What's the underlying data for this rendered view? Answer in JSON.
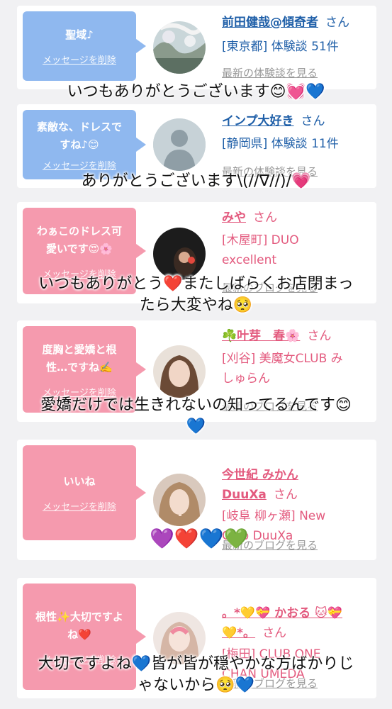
{
  "cards": [
    {
      "message": "聖域♪",
      "delete_label": "メッセージを削除",
      "name": "前田健哉@傾奇者",
      "honorific": "さん",
      "area": "[東京都] 体験談 51件",
      "latest_link": "最新の体験談を見る",
      "overlay": "いつもありがとうございます😊💓💙",
      "theme_color": "#8fb8ef"
    },
    {
      "message": "素敵な、ドレスで\nすね♪😊",
      "delete_label": "メッセージを削除",
      "name": "インプ大好き",
      "honorific": "さん",
      "area": "[静岡県] 体験談 11件",
      "latest_link": "最新の体験談を見る",
      "avatar_text": "no photo",
      "overlay": "ありがとうございます\\(//∇//)/💗",
      "theme_color": "#8fb8ef"
    },
    {
      "message": "わぁこのドレス可\n愛いです😍🌸",
      "delete_label": "メッセージを削除",
      "name": "みや",
      "honorific": "さん",
      "area": "[木屋町] DUO\nexcellent",
      "latest_link": "最新のブログを見る",
      "overlay": "いつもありがとう❤️またしばらくお店閉まっ\nたら大変やね🥺",
      "theme_color": "#f59aae"
    },
    {
      "message": "度胸と愛嬌と根\n性…ですね✍️",
      "delete_label": "メッセージを削除",
      "name": "☘️叶芽　春🌸",
      "honorific": "さん",
      "area": "[刈谷] 美魔女CLUB み\nしゅらん",
      "latest_link": "最新のブログを見る",
      "overlay": "愛嬌だけでは生きれないの知ってるんです😊\n💙",
      "theme_color": "#f59aae"
    },
    {
      "message": "いいね",
      "delete_label": "メッセージを削除",
      "name": "今世紀 みかん\nDuuXa",
      "honorific": "さん",
      "area": "[岐阜 柳ヶ瀬] New\nClub DuuXa",
      "latest_link": "最新のブログを見る",
      "overlay": "💜❤️💙💚",
      "theme_color": "#f59aae"
    },
    {
      "message": "根性✨大切ですよ\nね❤️",
      "delete_label": "メッセージを削除",
      "name": "。*💛💝 かおる 🐱💝\n💛*。",
      "honorific": "さん",
      "area": "[梅田] CLUB ONE\nCHAN UMEDA",
      "latest_link": "最新のブログを見る",
      "overlay": "大切ですよね💙皆が皆が穏やかな方ばかりじ\nゃないから🥺💙",
      "theme_color": "#f59aae"
    }
  ]
}
